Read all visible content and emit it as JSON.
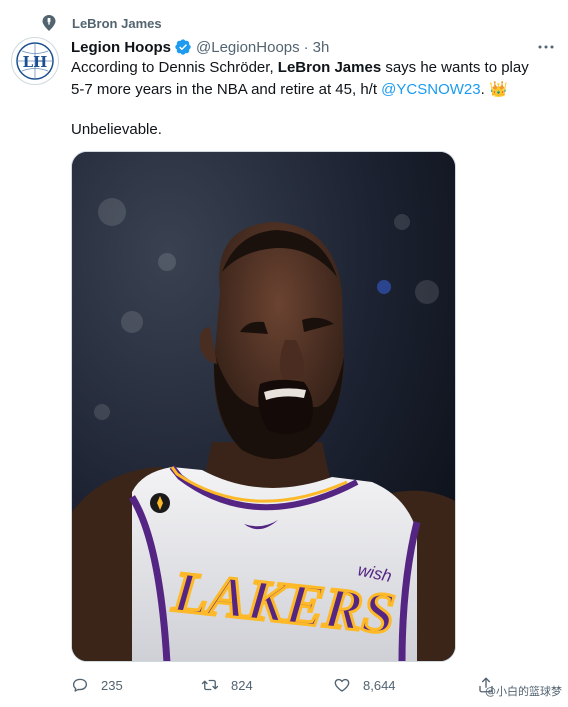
{
  "context": {
    "label": "LeBron James",
    "icon": "pin-icon"
  },
  "author": {
    "name": "Legion Hoops",
    "handle": "@LegionHoops",
    "separator": "·",
    "time": "3h",
    "verified_color": "#1d9bf0",
    "avatar_letters": "LH"
  },
  "tweet": {
    "text_before": "According to Dennis Schröder, ",
    "bold": "LeBron James",
    "text_after": " says he wants to play 5-7 more years in the NBA and retire at 45, h/t ",
    "mention": "@YCSNOW23",
    "trailing": ". ",
    "emoji": "👑",
    "second_paragraph": "Unbelievable."
  },
  "media": {
    "jersey_text": "LAKERS",
    "sponsor": "wish"
  },
  "actions": {
    "replies": "235",
    "retweets": "824",
    "likes": "8,644"
  },
  "watermark": "@小白的篮球梦",
  "colors": {
    "accent": "#1d9bf0",
    "muted": "#536471",
    "text": "#0f1419",
    "lakers_purple": "#552583",
    "lakers_gold": "#fdb927"
  }
}
